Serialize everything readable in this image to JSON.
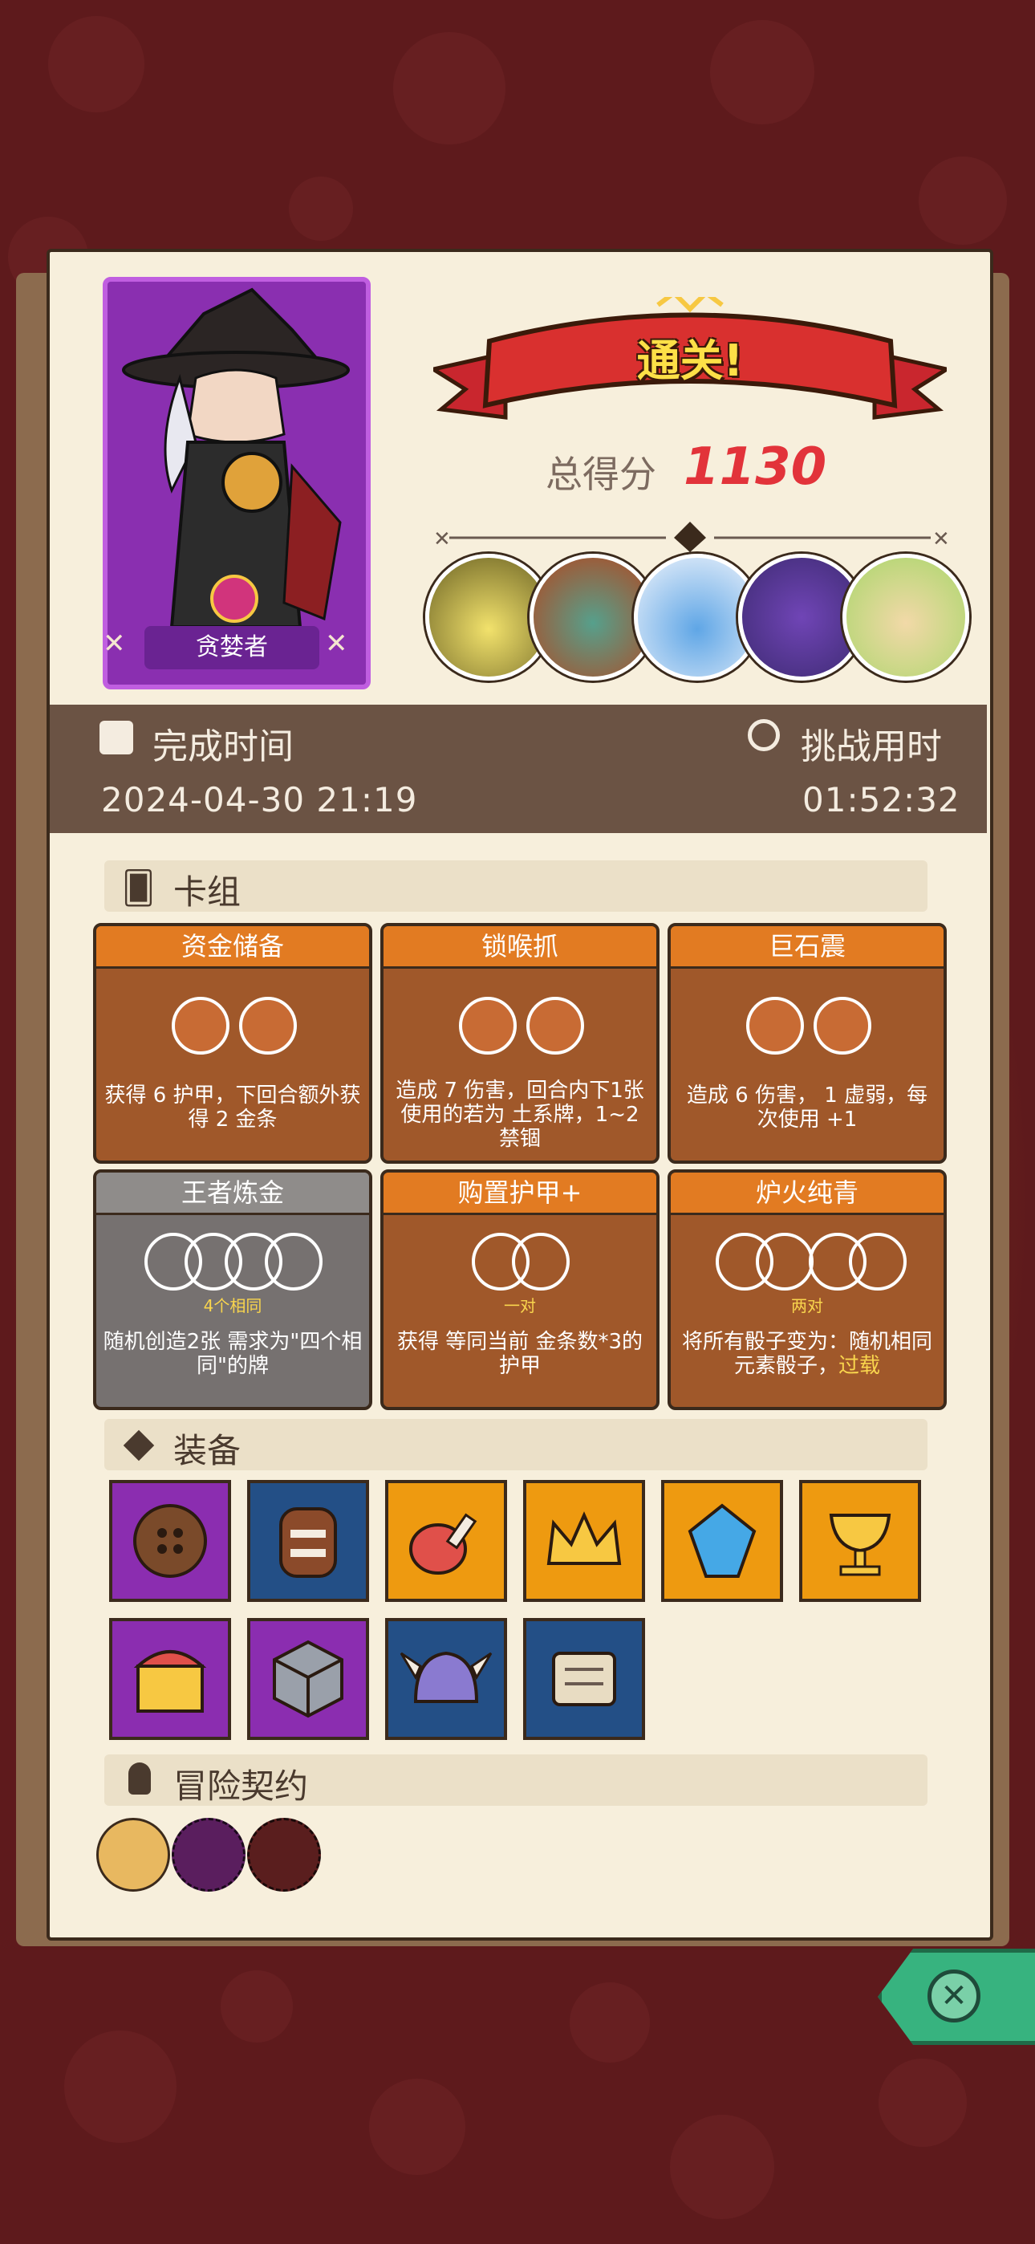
{
  "character": {
    "name": "贪婪者"
  },
  "result": {
    "banner": "通关!",
    "score_label": "总得分",
    "score_value": "1130"
  },
  "bosses": [
    "yellow-wizard-boss-icon",
    "orange-troll-boss-icon",
    "masked-beast-boss-icon",
    "purple-dragon-boss-icon",
    "elf-queen-boss-icon"
  ],
  "times": {
    "finish_label": "完成时间",
    "finish_value": "2024-04-30 21:19",
    "duration_label": "挑战用时",
    "duration_value": "01:52:32"
  },
  "deck": {
    "label": "卡组",
    "cards": [
      {
        "title": "资金储备",
        "desc": "获得 6 护甲，下回合额外获得 2 金条"
      },
      {
        "title": "锁喉抓",
        "desc": "造成 7 伤害，回合内下1张使用的若为 土系牌，1~2 禁锢"
      },
      {
        "title": "巨石震",
        "desc": "造成 6 伤害， 1 虚弱，每次使用 +1"
      },
      {
        "title": "王者炼金",
        "tag": "4个相同",
        "desc": "随机创造2张 需求为\"四个相同\"的牌"
      },
      {
        "title": "购置护甲+",
        "tag": "一对",
        "desc": "获得 等同当前 金条数*3的护甲"
      },
      {
        "title": "炉火纯青",
        "tag": "两对",
        "desc": "将所有骰子变为：随机相同元素骰子，",
        "highlight": "过载"
      }
    ]
  },
  "equipment": {
    "label": "装备",
    "items": [
      {
        "icon": "button-icon",
        "bg": "purple"
      },
      {
        "icon": "tribal-mask-icon",
        "bg": "blue"
      },
      {
        "icon": "meat-leg-icon",
        "bg": "orange"
      },
      {
        "icon": "crown-icon",
        "bg": "orange"
      },
      {
        "icon": "blue-gem-icon",
        "bg": "orange"
      },
      {
        "icon": "golden-chalice-icon",
        "bg": "orange"
      },
      {
        "icon": "treasure-chest-icon",
        "bg": "purple"
      },
      {
        "icon": "maze-cube-icon",
        "bg": "purple"
      },
      {
        "icon": "horned-helmet-icon",
        "bg": "blue"
      },
      {
        "icon": "scroll-icon",
        "bg": "blue"
      }
    ]
  },
  "contract": {
    "label": "冒险契约",
    "items": [
      "scroll-contract-icon",
      "bone-contract-icon",
      "meat-contract-icon"
    ]
  },
  "colors": {
    "accent": "#e2333a",
    "banner": "#c9262e",
    "panel": "#f7efdc",
    "card": "#a0582a"
  }
}
